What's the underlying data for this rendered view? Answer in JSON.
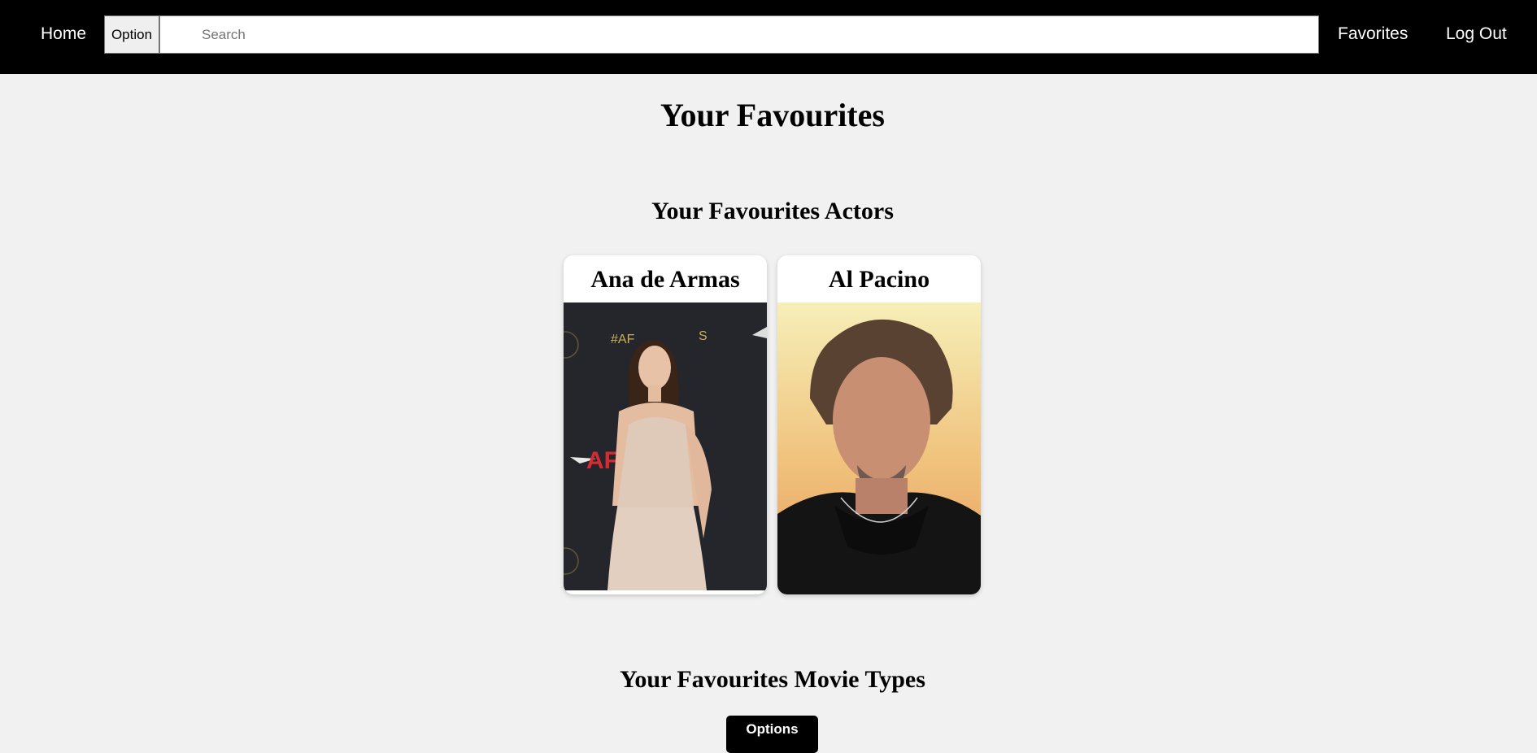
{
  "navbar": {
    "home_label": "Home",
    "option_label": "Option",
    "search": {
      "value": "",
      "placeholder": "Search"
    },
    "favorites_label": "Favorites",
    "logout_label": "Log Out"
  },
  "page": {
    "title": "Your Favourites"
  },
  "actors_section": {
    "title": "Your Favourites Actors",
    "actors": [
      {
        "name": "Ana de Armas",
        "photo": "actor-photo-ana-de-armas"
      },
      {
        "name": "Al Pacino",
        "photo": "actor-photo-al-pacino"
      }
    ]
  },
  "movie_types_section": {
    "title": "Your Favourites Movie Types",
    "options_label": "Options"
  },
  "colors": {
    "navbar_bg": "#000000",
    "page_bg": "#f1f1f1",
    "card_bg": "#ffffff",
    "button_bg": "#000000"
  }
}
